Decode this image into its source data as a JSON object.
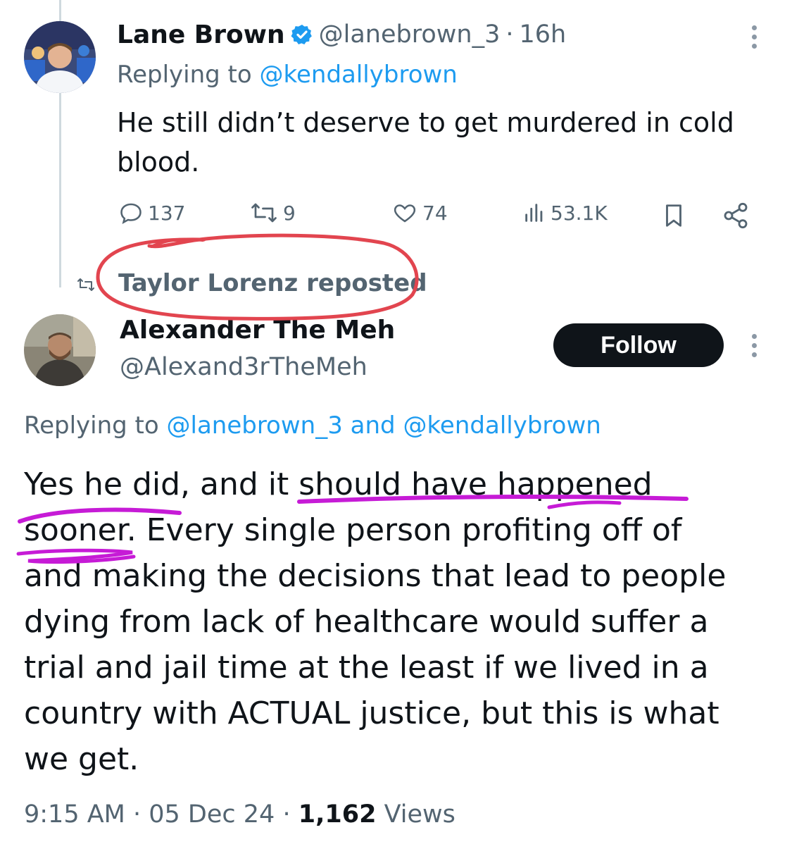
{
  "tweet1": {
    "name": "Lane Brown",
    "handle": "@lanebrown_3",
    "separator": "·",
    "time": "16h",
    "replying_prefix": "Replying to ",
    "replying_handle": "@kendallybrown",
    "text_line1": "He still didn’t deserve to get murdered in cold",
    "text_line2": "blood.",
    "stats": {
      "replies": "137",
      "reposts": "9",
      "likes": "74",
      "views": "53.1K"
    }
  },
  "repost_label": "Taylor Lorenz reposted",
  "tweet2": {
    "name": "Alexander The Meh",
    "handle": "@Alexand3rTheMeh",
    "follow_label": "Follow",
    "replying_prefix": "Replying to ",
    "replying_handle1": "@lanebrown_3",
    "replying_and": " and ",
    "replying_handle2": "@kendallybrown",
    "lines": [
      "Yes he did, and it should have happened",
      "sooner. Every single person profiting off of",
      "and making the decisions that lead to people",
      "dying from lack of healthcare would suffer a",
      "trial and jail time at the least if we lived in a",
      "country with ACTUAL justice, but this is what",
      "we get."
    ],
    "time": "9:15 AM",
    "sep": " · ",
    "date": "05 Dec 24",
    "views_count": "1,162",
    "views_label": " Views"
  },
  "colors": {
    "text": "#0f1419",
    "muted": "#536471",
    "link": "#1d9bf0",
    "verified": "#1d9bf0",
    "annotation_red": "#e2454f",
    "annotation_magenta": "#c61bd6"
  },
  "icons": [
    "verified-badge-icon",
    "more-icon",
    "reply-icon",
    "repost-icon",
    "like-icon",
    "views-icon",
    "bookmark-icon",
    "share-icon"
  ]
}
